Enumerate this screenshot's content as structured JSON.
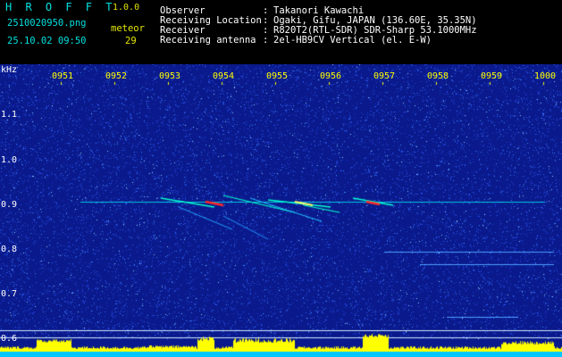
{
  "header": {
    "app_name": "H R O F F T",
    "version": "1.0.0",
    "filename": "2510020950.png",
    "datetime": "25.10.02 09:50",
    "meteor_label": "meteor",
    "meteor_count": "29",
    "info": [
      {
        "label": "Observer",
        "sep": ":",
        "value": "Takanori Kawachi"
      },
      {
        "label": "Receiving Location",
        "sep": ":",
        "value": "Ogaki, Gifu, JAPAN (136.60E, 35.35N)"
      },
      {
        "label": "Receiver",
        "sep": ":",
        "value": "R820T2(RTL-SDR) SDR-Sharp 53.1000MHz"
      },
      {
        "label": "Receiving antenna",
        "sep": ":",
        "value": "2el-HB9CV Vertical (el. E-W)"
      }
    ]
  },
  "spectrogram": {
    "y_unit": "kHz",
    "y_ticks": [
      "1.1",
      "1.0",
      "0.9",
      "0.8",
      "0.7",
      "0.6"
    ],
    "time_ticks": [
      "0951",
      "0952",
      "0953",
      "0954",
      "0955",
      "0956",
      "0957",
      "0958",
      "0959",
      "1000"
    ],
    "colors": {
      "background": "#0a1a8c",
      "noise": "#2a58ff",
      "echo": "#00ffff",
      "strong": "#ff2a2a",
      "level": "#ffff00",
      "tick": "#ffff00"
    }
  }
}
